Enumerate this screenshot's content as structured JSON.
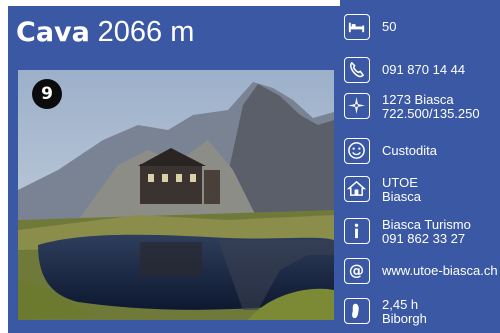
{
  "hut": {
    "name": "Cava",
    "altitude": "2066 m",
    "number": "9"
  },
  "info": {
    "beds": "50",
    "phone": "091 870 14 44",
    "location": [
      "1273 Biasca",
      "722.500/135.250"
    ],
    "status": "Custodita",
    "owner": [
      "UTOE",
      "Biasca"
    ],
    "tourism": [
      "Biasca Turismo",
      "091 862 33 27"
    ],
    "website": "www.utoe-biasca.ch",
    "walk": [
      "2,45 h",
      "Biborgh"
    ]
  },
  "icons": [
    "bed-icon",
    "phone-icon",
    "compass-icon",
    "smile-icon",
    "house-icon",
    "info-icon",
    "at-icon",
    "footprint-icon"
  ],
  "colors": {
    "accent": "#3a58a3",
    "text": "#ffffff"
  }
}
